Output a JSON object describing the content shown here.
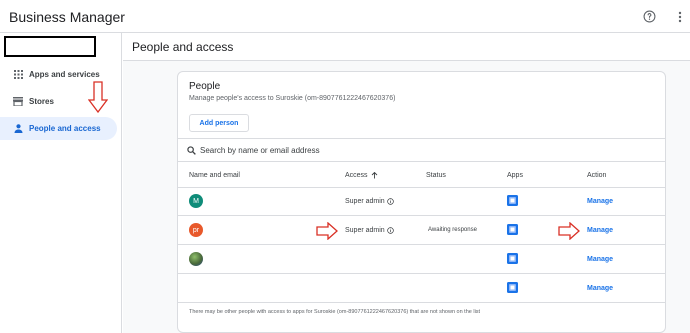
{
  "app": {
    "title": "Business Manager"
  },
  "sidebar": {
    "items": [
      {
        "label": "Apps and services",
        "icon": "apps-grid-icon"
      },
      {
        "label": "Stores",
        "icon": "store-icon"
      },
      {
        "label": "People and access",
        "icon": "person-icon",
        "active": true
      }
    ]
  },
  "main": {
    "title": "People and access"
  },
  "card": {
    "title": "People",
    "subtitle": "Manage people's access to Suroskie (om-8907761222467620376)",
    "add_button": "Add person",
    "search_placeholder": "Search by name or email address",
    "columns": {
      "name": "Name and email",
      "access": "Access",
      "status": "Status",
      "apps": "Apps",
      "action": "Action"
    },
    "rows": [
      {
        "avatar": "M",
        "avatar_color": "#0f8c79",
        "access": "Super admin",
        "status": "",
        "action": "Manage"
      },
      {
        "avatar": "pr",
        "avatar_color": "#e8592b",
        "access": "Super admin",
        "status": "Awaiting response",
        "action": "Manage"
      },
      {
        "avatar": "",
        "avatar_color": "#4a6a3a",
        "access": "",
        "status": "",
        "action": "Manage"
      },
      {
        "avatar": "",
        "avatar_color": "",
        "access": "",
        "status": "",
        "action": "Manage"
      }
    ],
    "footer": "There may be other people with access to apps for Suroskie (om-8907761222467620376) that are not shown on the list"
  },
  "colors": {
    "accent": "#1a73e8",
    "active_bg": "#e8f0fe",
    "annotation_red": "#d93025"
  }
}
